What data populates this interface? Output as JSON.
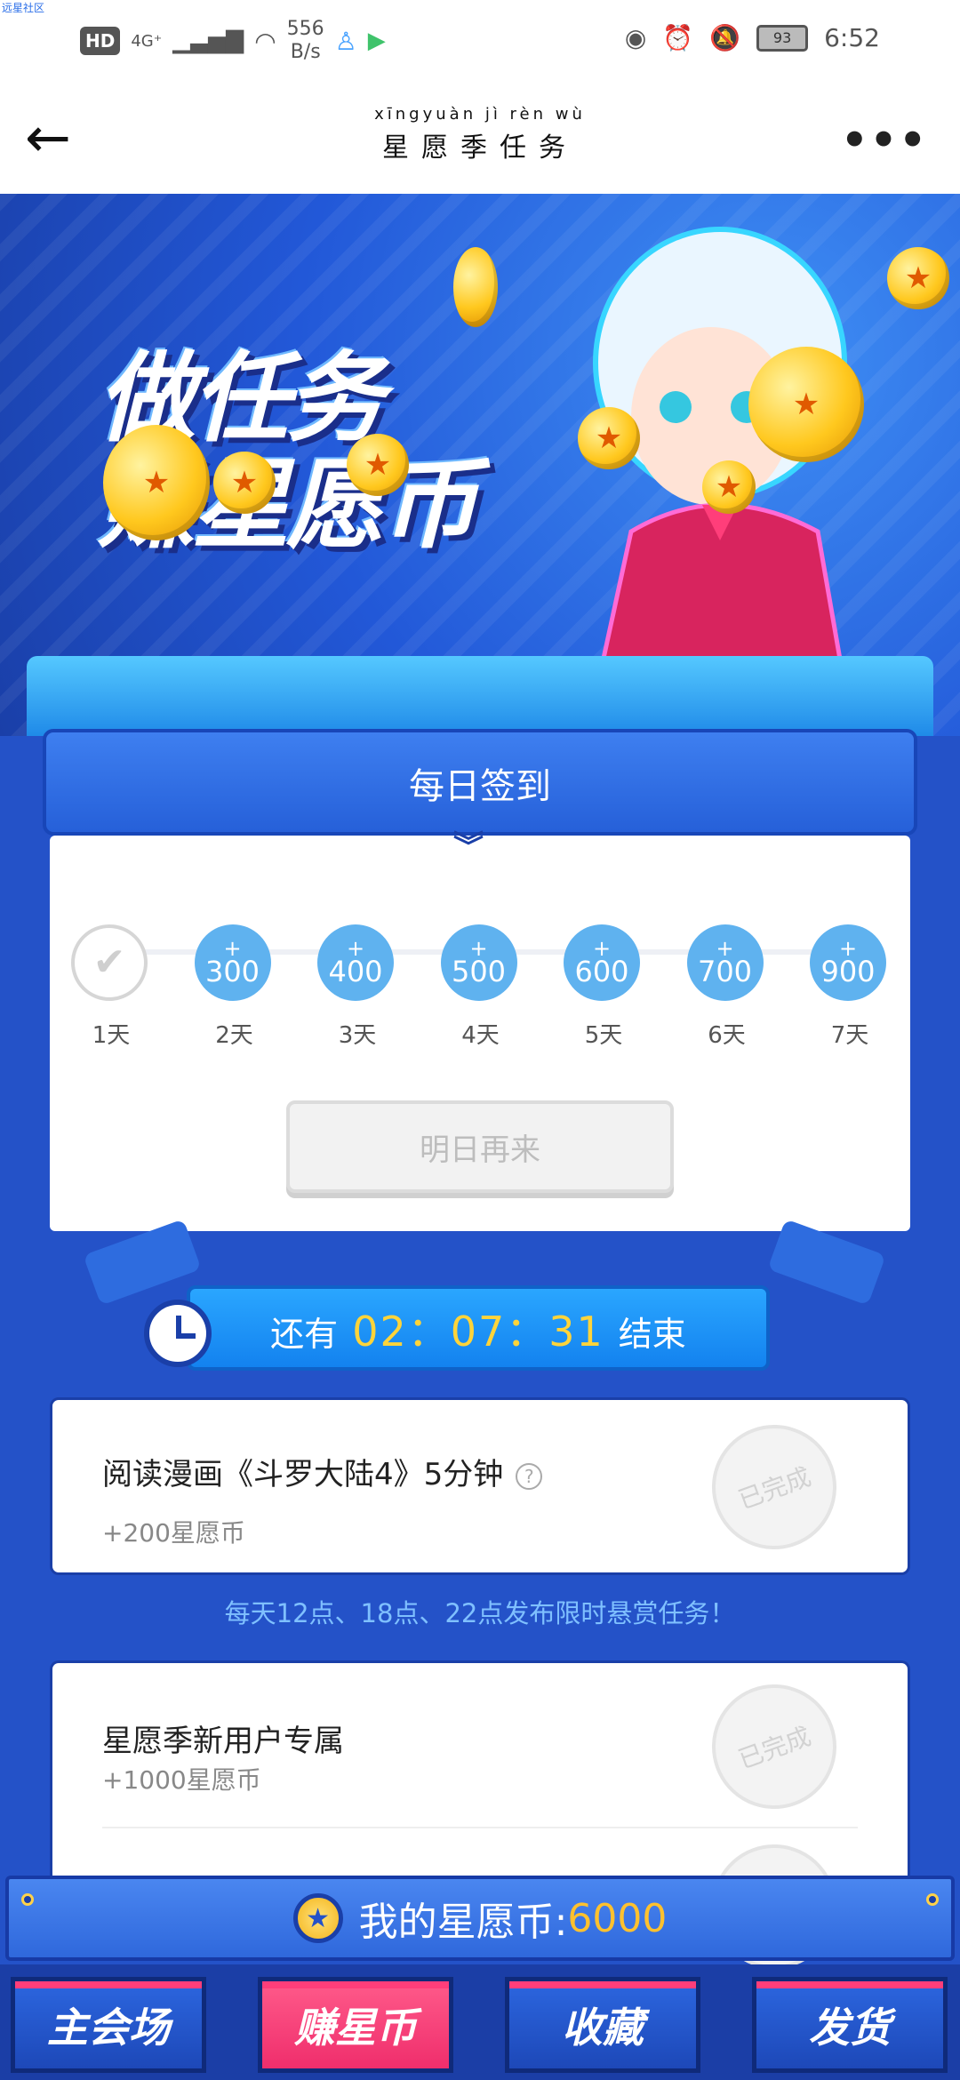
{
  "status_bar": {
    "corner_text": "远星社区",
    "hd": "HD",
    "network": "4G⁺",
    "speed": "556",
    "speed_unit": "B/s",
    "battery": "93",
    "time": "6:52"
  },
  "header": {
    "pinyin": "xīngyuàn  jì  rèn wù",
    "title": "星愿季任务",
    "more": "•••"
  },
  "banner": {
    "line1": "做任务",
    "line2": "赚星愿币"
  },
  "checkin": {
    "title": "每日签到",
    "days": [
      {
        "label": "1天",
        "value": "",
        "done": true
      },
      {
        "label": "2天",
        "value": "300",
        "done": false
      },
      {
        "label": "3天",
        "value": "400",
        "done": false
      },
      {
        "label": "4天",
        "value": "500",
        "done": false
      },
      {
        "label": "5天",
        "value": "600",
        "done": false
      },
      {
        "label": "6天",
        "value": "700",
        "done": false
      },
      {
        "label": "7天",
        "value": "900",
        "done": false
      }
    ],
    "plus": "+",
    "button": "明日再来"
  },
  "countdown": {
    "prefix": "还有",
    "time": "02：07：31",
    "suffix": "结束"
  },
  "tasks": [
    {
      "title": "阅读漫画《斗罗大陆4》5分钟",
      "reward": "+200星愿币",
      "status": "已完成"
    },
    {
      "title": "星愿季新用户专属",
      "reward": "+1000星愿币",
      "status": "已完成"
    }
  ],
  "notice": "每天12点、18点、22点发布限时悬赏任务！",
  "coins_bar": {
    "label": "我的星愿币:",
    "value": "6000"
  },
  "nav": [
    "主会场",
    "赚星币",
    "收藏",
    "发货"
  ],
  "colors": {
    "primary_blue": "#2452c8",
    "accent_pink": "#ef2e6c",
    "coin_gold": "#ffc12e"
  }
}
